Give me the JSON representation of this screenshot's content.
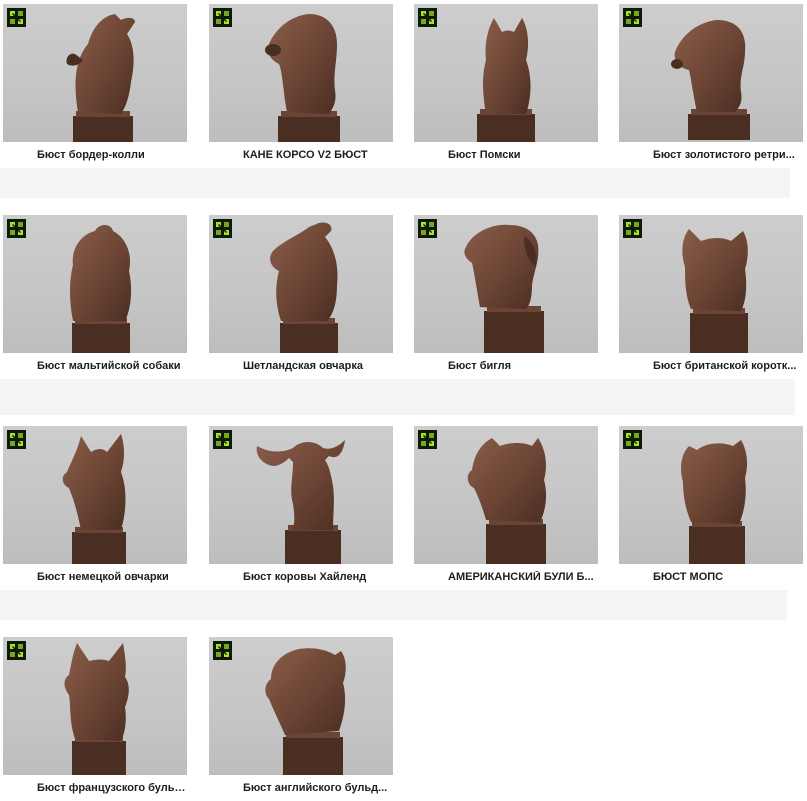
{
  "colors": {
    "badge_bg": "#0d1a05",
    "badge_accent": "#a6e22e",
    "bronze_dark": "#4a2e22",
    "bronze_mid": "#6b4434",
    "bronze_light": "#8a5d49",
    "background": "#c6c6c6"
  },
  "badge_icon": "cults-3d-logo-icon",
  "products": [
    {
      "title": "Бюст бордер-колли",
      "animal": "border-collie"
    },
    {
      "title": "КАНЕ КОРСО V2 БЮСТ",
      "animal": "cane-corso"
    },
    {
      "title": "Бюст Помски",
      "animal": "pomsky"
    },
    {
      "title": "Бюст золотистого ретри...",
      "animal": "golden-retriever"
    },
    {
      "title": "Бюст мальтийской собаки",
      "animal": "maltese"
    },
    {
      "title": "Шетландская овчарка",
      "animal": "sheltie"
    },
    {
      "title": "Бюст бигля",
      "animal": "beagle"
    },
    {
      "title": "Бюст британской коротк...",
      "animal": "british-shorthair"
    },
    {
      "title": "Бюст немецкой овчарки",
      "animal": "german-shepherd"
    },
    {
      "title": "Бюст коровы Хайленд",
      "animal": "highland-cow"
    },
    {
      "title": "АМЕРИКАНСКИЙ БУЛИ Б...",
      "animal": "american-bully"
    },
    {
      "title": "БЮСТ МОПС",
      "animal": "pug"
    },
    {
      "title": "Бюст французского бульд...",
      "animal": "french-bulldog"
    },
    {
      "title": "Бюст английского бульд...",
      "animal": "english-bulldog"
    }
  ]
}
